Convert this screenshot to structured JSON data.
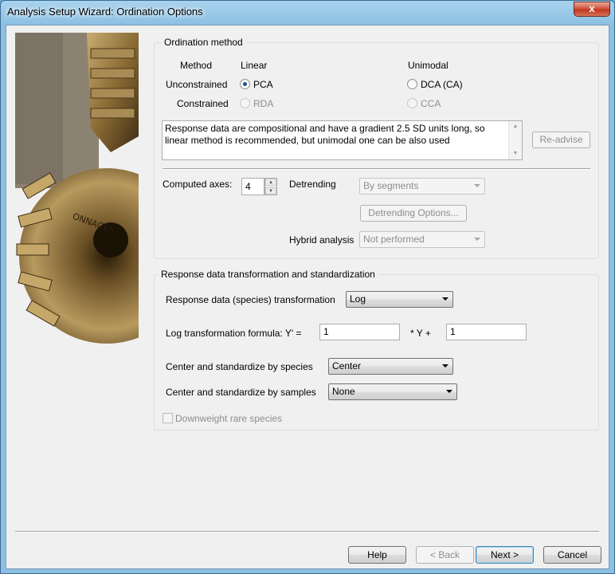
{
  "window": {
    "title": "Analysis Setup Wizard: Ordination Options",
    "close_glyph": "x"
  },
  "ordination": {
    "group_title": "Ordination method",
    "col_method": "Method",
    "col_linear": "Linear",
    "col_unimodal": "Unimodal",
    "row_unconstrained": "Unconstrained",
    "row_constrained": "Constrained",
    "pca": "PCA",
    "dca": "DCA (CA)",
    "rda": "RDA",
    "cca": "CCA",
    "selected": "PCA",
    "advice": "Response data are compositional and have a gradient 2.5 SD units long, so linear method is recommended, but unimodal one can be also used",
    "readvise_button": "Re-advise",
    "computed_axes_label": "Computed axes:",
    "computed_axes_value": "4",
    "detrending_label": "Detrending",
    "detrending_value": "By segments",
    "detrending_options_button": "Detrending Options...",
    "hybrid_label": "Hybrid analysis",
    "hybrid_value": "Not performed"
  },
  "transform": {
    "group_title": "Response data transformation and standardization",
    "species_transform_label": "Response data (species) transformation",
    "species_transform_value": "Log",
    "log_formula_label": "Log transformation formula: Y' =",
    "log_a_value": "1",
    "times_y_plus": "* Y +",
    "log_b_value": "1",
    "center_species_label": "Center and standardize by species",
    "center_species_value": "Center",
    "center_samples_label": "Center and standardize by samples",
    "center_samples_value": "None",
    "downweight_label": "Downweight rare species"
  },
  "footer": {
    "help": "Help",
    "back": "< Back",
    "next": "Next >",
    "cancel": "Cancel"
  },
  "icons": {
    "art": "keys-image",
    "spin_up": "▲",
    "spin_down": "▼",
    "scroll_up": "▲",
    "scroll_down": "▼"
  }
}
